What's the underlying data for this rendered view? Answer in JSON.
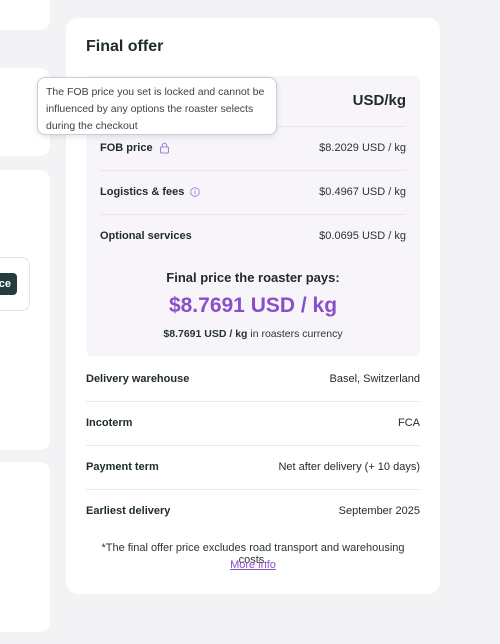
{
  "offer": {
    "title": "Final offer",
    "currency_header": "USD/kg",
    "price_rows": [
      {
        "label": "FOB price",
        "value": "$8.2029 USD / kg",
        "icon": "lock-icon"
      },
      {
        "label": "Logistics & fees",
        "value": "$0.4967 USD / kg",
        "icon": "info-icon"
      },
      {
        "label": "Optional services",
        "value": "$0.0695 USD / kg"
      }
    ],
    "final_label": "Final price the roaster pays:",
    "final_price": "$8.7691 USD / kg",
    "final_local_price": "$8.7691 USD / kg",
    "final_local_suffix": " in roasters currency",
    "details": [
      {
        "label": "Delivery warehouse",
        "value": "Basel, Switzerland"
      },
      {
        "label": "Incoterm",
        "value": "FCA"
      },
      {
        "label": "Payment term",
        "value": "Net after delivery (+ 10 days)"
      },
      {
        "label": "Earliest delivery",
        "value": "September 2025"
      }
    ],
    "footnote": "*The final offer price excludes road transport and warehousing costs.",
    "more_info": "More info"
  },
  "tooltip": {
    "text": "The FOB price you set is locked and cannot be influenced by any options the roaster selects during the checkout"
  },
  "left_panel": {
    "button_fragment": "ce"
  },
  "colors": {
    "accent": "#8a4fc8",
    "text": "#1f2a2a",
    "page_bg": "#f3f2f5",
    "price_box_bg": "#f7f5fa",
    "dark_button": "#243c3c"
  }
}
